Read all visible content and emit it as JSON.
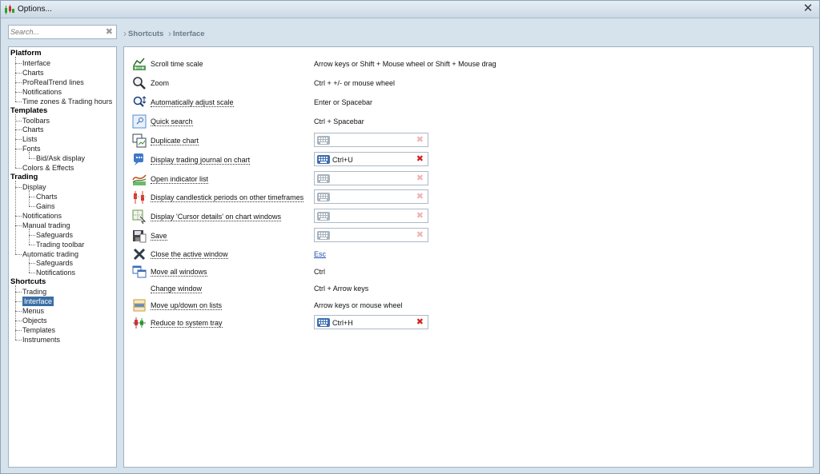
{
  "window": {
    "title": "Options...",
    "close_glyph": "✕"
  },
  "search": {
    "placeholder": "Search...",
    "clear_glyph": "✖"
  },
  "breadcrumb": [
    "Shortcuts",
    "Interface"
  ],
  "tree": [
    {
      "label": "Platform",
      "level": 0
    },
    {
      "label": "Interface",
      "level": 1
    },
    {
      "label": "Charts",
      "level": 1
    },
    {
      "label": "ProRealTrend lines",
      "level": 1
    },
    {
      "label": "Notifications",
      "level": 1
    },
    {
      "label": "Time zones & Trading hours",
      "level": 1
    },
    {
      "label": "Templates",
      "level": 0
    },
    {
      "label": "Toolbars",
      "level": 1
    },
    {
      "label": "Charts",
      "level": 1
    },
    {
      "label": "Lists",
      "level": 1
    },
    {
      "label": "Fonts",
      "level": 1
    },
    {
      "label": "Bid/Ask display",
      "level": 2
    },
    {
      "label": "Colors & Effects",
      "level": 1
    },
    {
      "label": "Trading",
      "level": 0
    },
    {
      "label": "Display",
      "level": 1
    },
    {
      "label": "Charts",
      "level": 2
    },
    {
      "label": "Gains",
      "level": 2
    },
    {
      "label": "Notifications",
      "level": 1
    },
    {
      "label": "Manual trading",
      "level": 1
    },
    {
      "label": "Safeguards",
      "level": 2
    },
    {
      "label": "Trading toolbar",
      "level": 2
    },
    {
      "label": "Automatic trading",
      "level": 1
    },
    {
      "label": "Safeguards",
      "level": 2
    },
    {
      "label": "Notifications",
      "level": 2
    },
    {
      "label": "Shortcuts",
      "level": 0
    },
    {
      "label": "Trading",
      "level": 1
    },
    {
      "label": "Interface",
      "level": 1,
      "selected": true
    },
    {
      "label": "Menus",
      "level": 1
    },
    {
      "label": "Objects",
      "level": 1
    },
    {
      "label": "Templates",
      "level": 1
    },
    {
      "label": "Instruments",
      "level": 1
    }
  ],
  "shortcuts": [
    {
      "icon": "scroll-time-scale-icon",
      "label": "Scroll time scale",
      "link": false,
      "value": "Arrow keys or Shift + Mouse wheel or Shift + Mouse drag"
    },
    {
      "icon": "zoom-icon",
      "label": "Zoom",
      "link": false,
      "value": "Ctrl + +/- or mouse wheel"
    },
    {
      "icon": "auto-adjust-scale-icon",
      "label": "Automatically adjust scale",
      "link": true,
      "value": "Enter or Spacebar"
    },
    {
      "icon": "quick-search-icon",
      "label": "Quick search",
      "link": true,
      "value": "Ctrl + Spacebar"
    },
    {
      "icon": "duplicate-chart-icon",
      "label": "Duplicate chart",
      "link": true,
      "key": ""
    },
    {
      "icon": "trading-journal-icon",
      "label": "Display trading journal on chart",
      "link": true,
      "key": "Ctrl+U"
    },
    {
      "icon": "indicator-list-icon",
      "label": "Open indicator list",
      "link": true,
      "key": ""
    },
    {
      "icon": "candlestick-periods-icon",
      "label": "Display candlestick periods on other timeframes",
      "link": true,
      "key": ""
    },
    {
      "icon": "cursor-details-icon",
      "label": "Display 'Cursor details' on chart windows",
      "link": true,
      "key": ""
    },
    {
      "icon": "save-icon",
      "label": "Save",
      "link": true,
      "key": ""
    },
    {
      "icon": "close-window-icon",
      "label": "Close the active window",
      "link": true,
      "value": "Esc",
      "value_link": true
    },
    {
      "icon": "move-windows-icon",
      "label": "Move all windows",
      "link": true,
      "value": "Ctrl"
    },
    {
      "icon": "",
      "label": "Change window",
      "link": true,
      "value": "Ctrl + Arrow keys"
    },
    {
      "icon": "move-up-down-icon",
      "label": "Move up/down on lists",
      "link": true,
      "value": "Arrow keys or mouse wheel"
    },
    {
      "icon": "system-tray-icon",
      "label": "Reduce to system tray",
      "link": true,
      "key": "Ctrl+H"
    }
  ]
}
